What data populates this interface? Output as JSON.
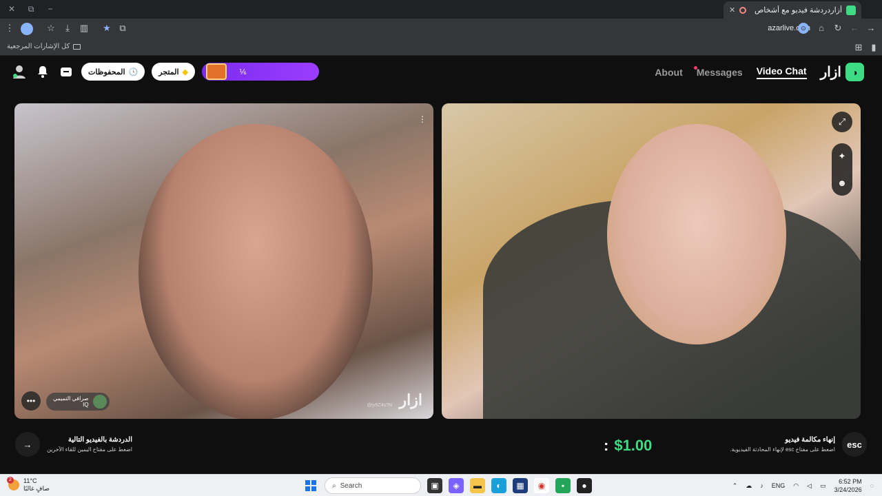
{
  "browser": {
    "tab_title": "أزاردردشة فيديو مع أشخاص",
    "url": "azarlive.com",
    "bookmarks_label": "كل الإشارات المرجعية",
    "win_controls": [
      "✕",
      "⧉",
      "−"
    ]
  },
  "site": {
    "logo_text": "ازار",
    "nav": [
      "Video Chat",
      "Messages",
      "About"
    ],
    "promo_text": "⅙",
    "store_label": "المتجر",
    "saved_label": "المحفوظات"
  },
  "left_video": {
    "watermark": "ازار",
    "handle": "@jy9Z4s?N",
    "user_name": "صرافي التميمي",
    "user_country": "IQ"
  },
  "right_video": {},
  "controls": {
    "next_title": "الدردشة بالفيديو التالية",
    "next_hint": "اضغط على مفتاح اليمين للقاء الآخرين",
    "end_title": "إنهاء مكالمة فيديو",
    "end_hint": "اضغط على مفتاح esc لإنهاء المحادثة الفيديوية.",
    "esc_label": "esc",
    "price": "$1.00",
    "price_colon": ":"
  },
  "taskbar": {
    "temp": "11°C",
    "weather_desc": "صافٍ غالبًا",
    "weather_badge": "2",
    "search_placeholder": "Search",
    "lang": "ENG",
    "time": "6:52 PM",
    "date": "3/24/2026"
  },
  "colors": {
    "accent_green": "#3ddc84",
    "promo_purple": "#9b3dff",
    "notify_dot": "#ff3b6b"
  }
}
